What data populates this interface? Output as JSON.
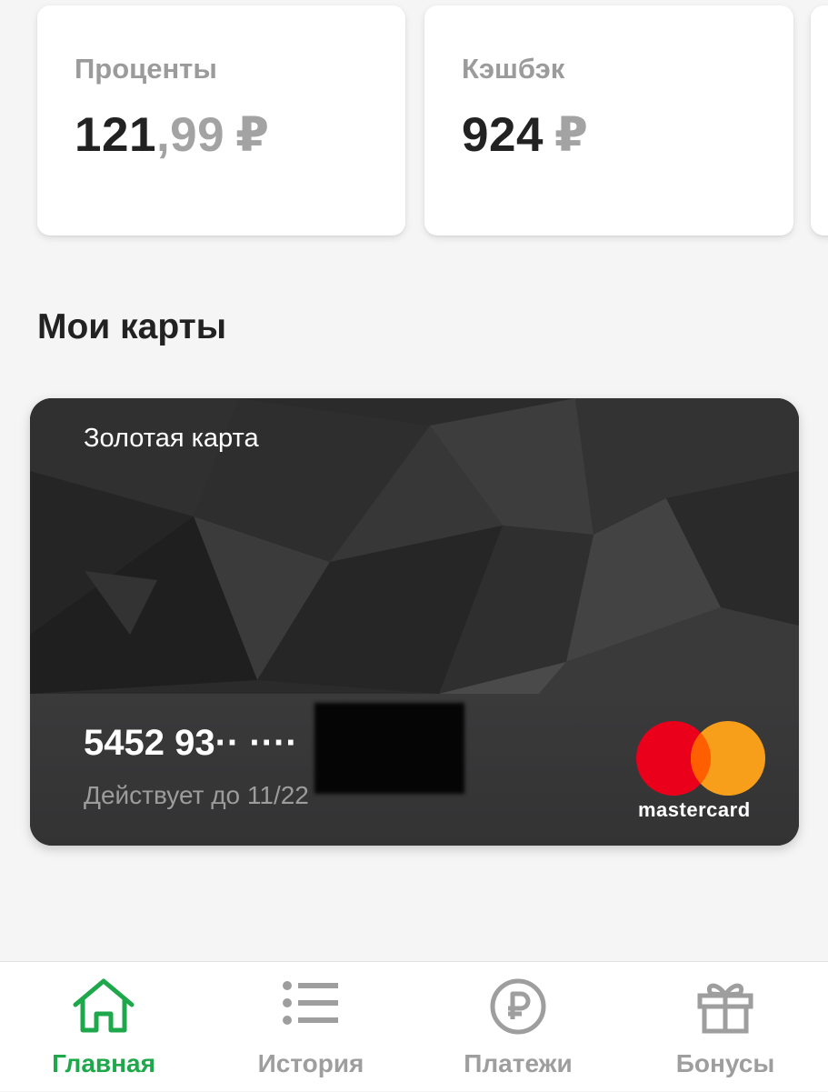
{
  "stats": [
    {
      "label": "Проценты",
      "int": "121",
      "frac": ",99",
      "currency": "₽"
    },
    {
      "label": "Кэшбэк",
      "int": "924",
      "frac": "",
      "currency": "₽"
    }
  ],
  "section_title": "Мои карты",
  "card": {
    "name": "Золотая карта",
    "number": "5452 93·· ····",
    "expiry": "Действует до 11/22",
    "brand": "mastercard"
  },
  "tabs": [
    {
      "label": "Главная",
      "icon": "home-icon",
      "active": true
    },
    {
      "label": "История",
      "icon": "list-icon",
      "active": false
    },
    {
      "label": "Платежи",
      "icon": "ruble-circle-icon",
      "active": false
    },
    {
      "label": "Бонусы",
      "icon": "gift-icon",
      "active": false
    }
  ],
  "colors": {
    "accent": "#1fa84b",
    "inactive": "#9e9e9e",
    "card_bg": "#2a2a2b",
    "mastercard_red": "#eb001b",
    "mastercard_orange": "#f79e1b"
  }
}
